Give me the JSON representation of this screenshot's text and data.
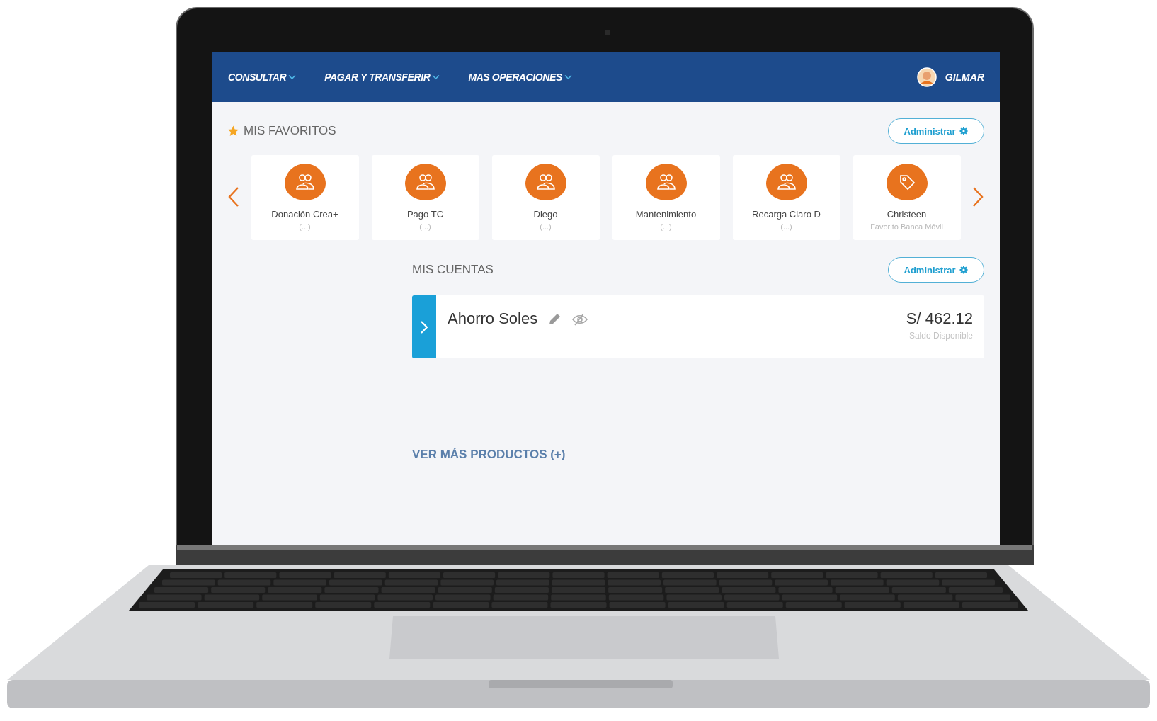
{
  "nav": {
    "items": [
      {
        "label": "CONSULTAR"
      },
      {
        "label": "PAGAR Y TRANSFERIR"
      },
      {
        "label": "MAS OPERACIONES"
      }
    ],
    "user": {
      "name": "GILMAR"
    }
  },
  "favorites": {
    "title": "MIS FAVORITOS",
    "manage_button": "Administrar",
    "items": [
      {
        "title": "Donación Crea+",
        "subtitle": "(...)",
        "kind": "people"
      },
      {
        "title": "Pago TC",
        "subtitle": "(...)",
        "kind": "people"
      },
      {
        "title": "Diego",
        "subtitle": "(...)",
        "kind": "people"
      },
      {
        "title": "Mantenimiento",
        "subtitle": "(...)",
        "kind": "people"
      },
      {
        "title": "Recarga Claro D",
        "subtitle": "(...)",
        "kind": "people"
      },
      {
        "title": "Christeen",
        "subtitle": "Favorito Banca Móvil",
        "kind": "tag"
      }
    ]
  },
  "accounts": {
    "title": "MIS CUENTAS",
    "manage_button": "Administrar",
    "items": [
      {
        "name": "Ahorro Soles",
        "amount": "S/ 462.12",
        "balance_label": "Saldo Disponible"
      }
    ]
  },
  "more_link": "VER MÁS PRODUCTOS (+)"
}
